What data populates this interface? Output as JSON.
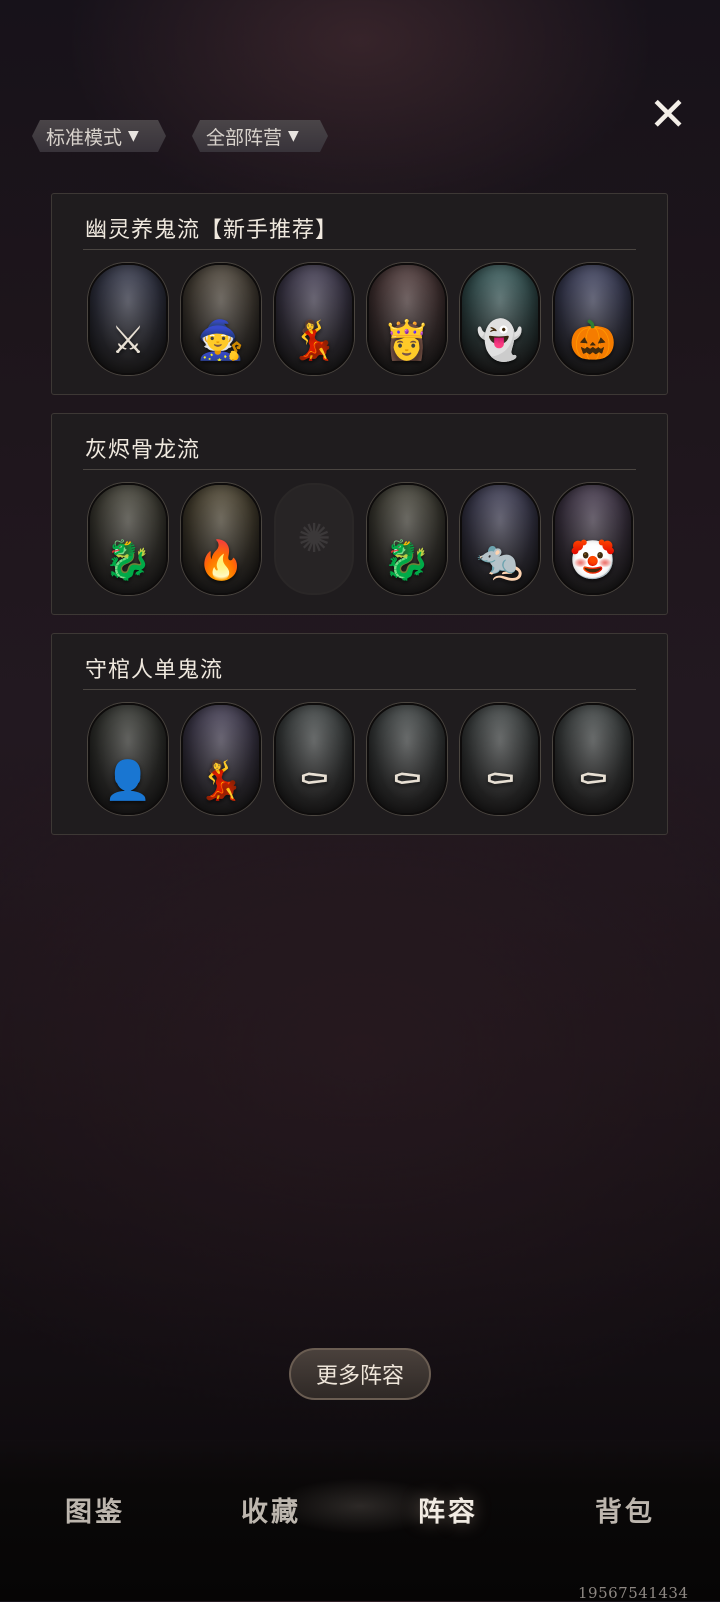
{
  "close": {
    "icon": "close-icon",
    "symbol": "✕"
  },
  "filters": {
    "mode": {
      "label": "标准模式",
      "icon": "▼"
    },
    "camp": {
      "label": "全部阵营",
      "icon": "▼"
    }
  },
  "teams": [
    {
      "title": "幽灵养鬼流【新手推荐】",
      "heroes": [
        {
          "icon": "dark-knight-icon",
          "glyph": "⚔",
          "bg": "#2a2e45"
        },
        {
          "icon": "old-witch-icon",
          "glyph": "🧙",
          "bg": "#4a4032"
        },
        {
          "icon": "purple-dancer-icon",
          "glyph": "💃",
          "bg": "#3c3550"
        },
        {
          "icon": "red-hair-statue-icon",
          "glyph": "👸",
          "bg": "#4a3030"
        },
        {
          "icon": "cyan-ghost-icon",
          "glyph": "👻",
          "bg": "#2f5a5a"
        },
        {
          "icon": "pumpkin-king-icon",
          "glyph": "🎃",
          "bg": "#363a5e"
        }
      ]
    },
    {
      "title": "灰烬骨龙流",
      "heroes": [
        {
          "icon": "bone-dragon-icon",
          "glyph": "🐉",
          "bg": "#3f3d30"
        },
        {
          "icon": "smoke-wizard-icon",
          "glyph": "🔥",
          "bg": "#4a4028"
        },
        {
          "icon": "empty-slot-icon",
          "glyph": "✺",
          "bg": "#272425",
          "empty": true
        },
        {
          "icon": "bone-dragon-icon",
          "glyph": "🐉",
          "bg": "#3f3d30"
        },
        {
          "icon": "rat-bandit-icon",
          "glyph": "🐀",
          "bg": "#363552"
        },
        {
          "icon": "clown-icon",
          "glyph": "🤡",
          "bg": "#3e3048"
        }
      ]
    },
    {
      "title": "守棺人单鬼流",
      "heroes": [
        {
          "icon": "hooded-shadow-icon",
          "glyph": "👤",
          "bg": "#2c2e28"
        },
        {
          "icon": "purple-dancer-icon",
          "glyph": "💃",
          "bg": "#3c3550"
        },
        {
          "icon": "coffin-keeper-icon",
          "glyph": "⚰",
          "bg": "#3a4040"
        },
        {
          "icon": "coffin-keeper-icon",
          "glyph": "⚰",
          "bg": "#3a4040"
        },
        {
          "icon": "coffin-keeper-icon",
          "glyph": "⚰",
          "bg": "#3a4040"
        },
        {
          "icon": "coffin-keeper-icon",
          "glyph": "⚰",
          "bg": "#3a4040"
        }
      ]
    }
  ],
  "more_button": "更多阵容",
  "nav": {
    "items": [
      "图鉴",
      "收藏",
      "阵容",
      "背包"
    ],
    "active_index": 2
  },
  "footer_id": "19567541434"
}
